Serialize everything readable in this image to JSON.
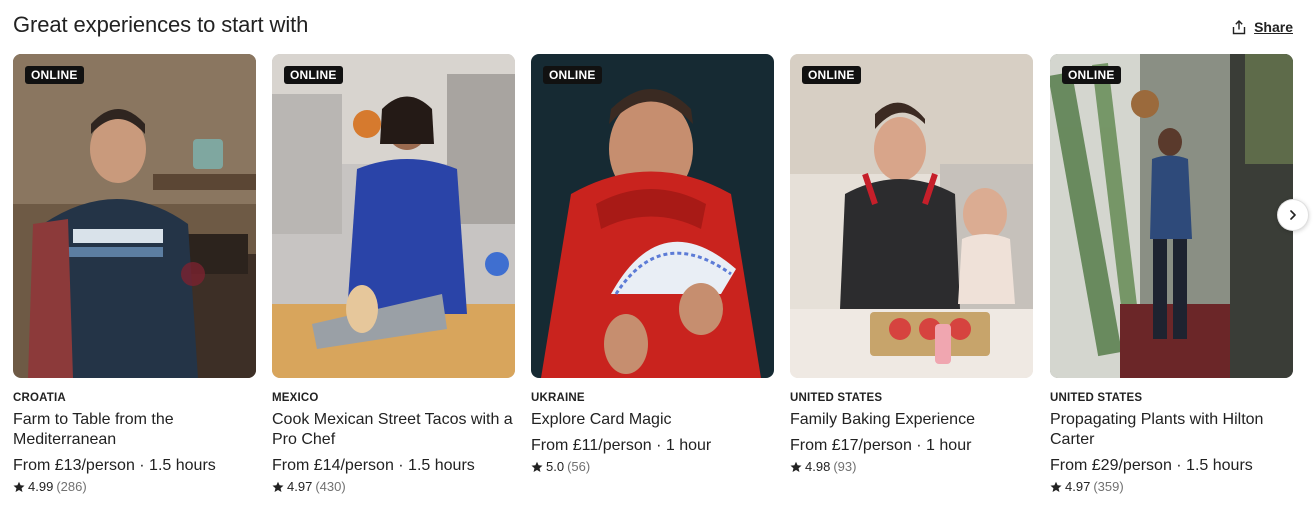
{
  "section": {
    "title": "Great experiences to start with",
    "share_label": "Share"
  },
  "icons": {
    "share": "share-icon",
    "star": "star-icon",
    "next": "chevron-right-icon"
  },
  "colors": {
    "badge_bg": "#111111",
    "text_primary": "#222222",
    "text_secondary": "#717171"
  },
  "cards": [
    {
      "badge": "ONLINE",
      "country": "CROATIA",
      "name": "Farm to Table from the Mediterranean",
      "price": "From £13/person · 1.5 hours",
      "rating": "4.99",
      "reviews": "(286)"
    },
    {
      "badge": "ONLINE",
      "country": "MEXICO",
      "name": "Cook Mexican Street Tacos with a Pro Chef",
      "price": "From £14/person · 1.5 hours",
      "rating": "4.97",
      "reviews": "(430)"
    },
    {
      "badge": "ONLINE",
      "country": "UKRAINE",
      "name": "Explore Card Magic",
      "price": "From £11/person · 1 hour",
      "rating": "5.0",
      "reviews": "(56)"
    },
    {
      "badge": "ONLINE",
      "country": "UNITED STATES",
      "name": "Family Baking Experience",
      "price": "From £17/person · 1 hour",
      "rating": "4.98",
      "reviews": "(93)"
    },
    {
      "badge": "ONLINE",
      "country": "UNITED STATES",
      "name": "Propagating Plants with Hilton Carter",
      "price": "From £29/person · 1.5 hours",
      "rating": "4.97",
      "reviews": "(359)"
    }
  ]
}
